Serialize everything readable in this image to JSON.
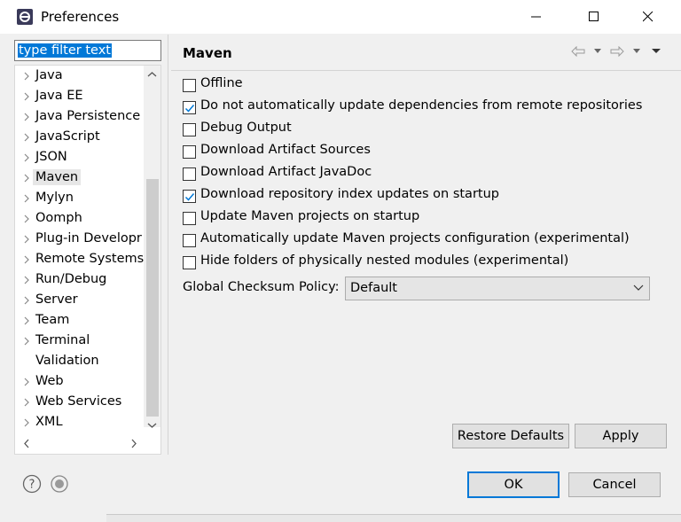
{
  "window": {
    "title": "Preferences"
  },
  "filter": {
    "placeholder": "type filter text"
  },
  "tree": {
    "items": [
      {
        "label": "Java",
        "expandable": true
      },
      {
        "label": "Java EE",
        "expandable": true
      },
      {
        "label": "Java Persistence",
        "expandable": true
      },
      {
        "label": "JavaScript",
        "expandable": true
      },
      {
        "label": "JSON",
        "expandable": true
      },
      {
        "label": "Maven",
        "expandable": true,
        "selected": true
      },
      {
        "label": "Mylyn",
        "expandable": true
      },
      {
        "label": "Oomph",
        "expandable": true
      },
      {
        "label": "Plug-in Developr",
        "expandable": true
      },
      {
        "label": "Remote Systems",
        "expandable": true
      },
      {
        "label": "Run/Debug",
        "expandable": true
      },
      {
        "label": "Server",
        "expandable": true
      },
      {
        "label": "Team",
        "expandable": true
      },
      {
        "label": "Terminal",
        "expandable": true
      },
      {
        "label": "Validation",
        "expandable": false
      },
      {
        "label": "Web",
        "expandable": true
      },
      {
        "label": "Web Services",
        "expandable": true
      },
      {
        "label": "XML",
        "expandable": true
      }
    ]
  },
  "page": {
    "title": "Maven",
    "options": [
      {
        "label": "Offline",
        "checked": false
      },
      {
        "label": "Do not automatically update dependencies from remote repositories",
        "checked": true
      },
      {
        "label": "Debug Output",
        "checked": false
      },
      {
        "label": "Download Artifact Sources",
        "checked": false
      },
      {
        "label": "Download Artifact JavaDoc",
        "checked": false
      },
      {
        "label": "Download repository index updates on startup",
        "checked": true
      },
      {
        "label": "Update Maven projects on startup",
        "checked": false
      },
      {
        "label": "Automatically update Maven projects configuration (experimental)",
        "checked": false
      },
      {
        "label": "Hide folders of physically nested modules (experimental)",
        "checked": false
      }
    ],
    "checksum_policy": {
      "label": "Global Checksum Policy:",
      "value": "Default"
    },
    "restore_defaults": "Restore Defaults",
    "apply": "Apply"
  },
  "footer": {
    "ok": "OK",
    "cancel": "Cancel"
  },
  "colors": {
    "accent": "#0078d7",
    "selection": "#e6e6e6",
    "check": "#0078d7"
  }
}
